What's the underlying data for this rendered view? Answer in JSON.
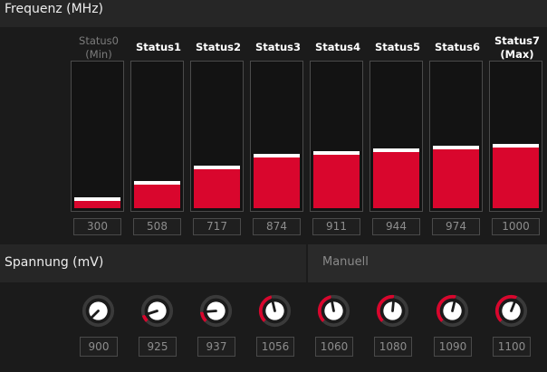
{
  "frequency": {
    "title": "Frequenz (MHz)",
    "scale_max": 1000,
    "accent_color": "#d9062d",
    "states": [
      {
        "name": "Status0",
        "sub": "(Min)",
        "value": "300",
        "enabled": false
      },
      {
        "name": "Status1",
        "sub": "",
        "value": "508",
        "enabled": true
      },
      {
        "name": "Status2",
        "sub": "",
        "value": "717",
        "enabled": true
      },
      {
        "name": "Status3",
        "sub": "",
        "value": "874",
        "enabled": true
      },
      {
        "name": "Status4",
        "sub": "",
        "value": "911",
        "enabled": true
      },
      {
        "name": "Status5",
        "sub": "",
        "value": "944",
        "enabled": true
      },
      {
        "name": "Status6",
        "sub": "",
        "value": "974",
        "enabled": true
      },
      {
        "name": "Status7",
        "sub": "(Max)",
        "value": "1000",
        "enabled": true
      }
    ]
  },
  "voltage": {
    "title": "Spannung (mV)",
    "mode": "Manuell",
    "knobs": [
      {
        "value": "900",
        "level": 0.0
      },
      {
        "value": "925",
        "level": 0.1
      },
      {
        "value": "937",
        "level": 0.15
      },
      {
        "value": "1056",
        "level": 0.45
      },
      {
        "value": "1060",
        "level": 0.46
      },
      {
        "value": "1080",
        "level": 0.52
      },
      {
        "value": "1090",
        "level": 0.55
      },
      {
        "value": "1100",
        "level": 0.58
      }
    ]
  }
}
